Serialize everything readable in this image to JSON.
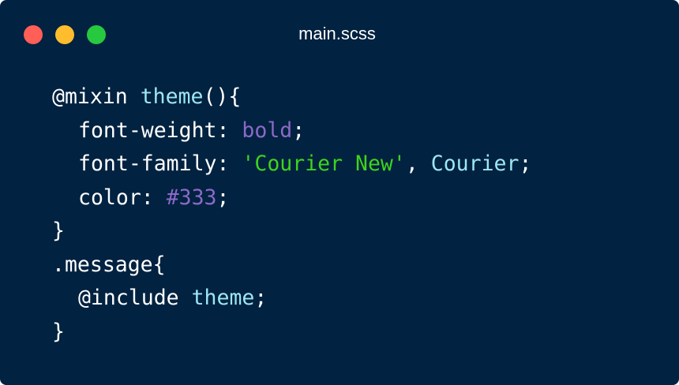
{
  "window": {
    "title": "main.scss",
    "background": "#012240",
    "controls": {
      "close_color": "#ff5f56",
      "minimize_color": "#ffbd2e",
      "zoom_color": "#27c93f"
    }
  },
  "code": {
    "colors": {
      "default": "#ffffff",
      "identifier": "#9de7f4",
      "value": "#8b69c8",
      "string": "#3ed31d"
    },
    "lines": [
      {
        "indent": 0,
        "tokens": [
          {
            "text": "@mixin ",
            "kind": "default"
          },
          {
            "text": "theme",
            "kind": "identifier"
          },
          {
            "text": "(){",
            "kind": "default"
          }
        ]
      },
      {
        "indent": 1,
        "tokens": [
          {
            "text": "font-weight: ",
            "kind": "default"
          },
          {
            "text": "bold",
            "kind": "value"
          },
          {
            "text": ";",
            "kind": "default"
          }
        ]
      },
      {
        "indent": 1,
        "tokens": [
          {
            "text": "font-family: ",
            "kind": "default"
          },
          {
            "text": "'Courier New'",
            "kind": "string"
          },
          {
            "text": ", ",
            "kind": "default"
          },
          {
            "text": "Courier",
            "kind": "identifier"
          },
          {
            "text": ";",
            "kind": "default"
          }
        ]
      },
      {
        "indent": 1,
        "tokens": [
          {
            "text": "color: ",
            "kind": "default"
          },
          {
            "text": "#333",
            "kind": "value"
          },
          {
            "text": ";",
            "kind": "default"
          }
        ]
      },
      {
        "indent": 0,
        "tokens": [
          {
            "text": "}",
            "kind": "default"
          }
        ]
      },
      {
        "indent": 0,
        "tokens": [
          {
            "text": ".message{",
            "kind": "default"
          }
        ]
      },
      {
        "indent": 1,
        "tokens": [
          {
            "text": "@include ",
            "kind": "default"
          },
          {
            "text": "theme",
            "kind": "identifier"
          },
          {
            "text": ";",
            "kind": "default"
          }
        ]
      },
      {
        "indent": 0,
        "tokens": [
          {
            "text": "}",
            "kind": "default"
          }
        ]
      }
    ]
  }
}
